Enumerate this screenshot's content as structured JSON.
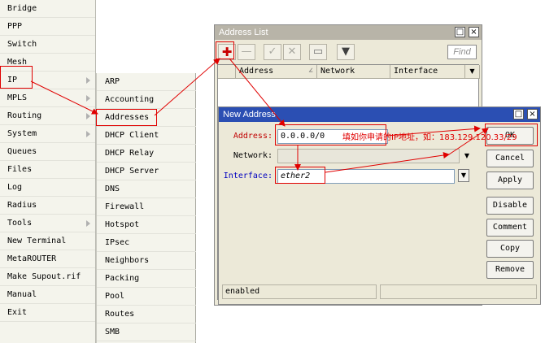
{
  "main_menu": {
    "items": [
      {
        "label": "Bridge",
        "has_submenu": false
      },
      {
        "label": "PPP",
        "has_submenu": false
      },
      {
        "label": "Switch",
        "has_submenu": false
      },
      {
        "label": "Mesh",
        "has_submenu": false
      },
      {
        "label": "IP",
        "has_submenu": true
      },
      {
        "label": "MPLS",
        "has_submenu": true
      },
      {
        "label": "Routing",
        "has_submenu": true
      },
      {
        "label": "System",
        "has_submenu": true
      },
      {
        "label": "Queues",
        "has_submenu": false
      },
      {
        "label": "Files",
        "has_submenu": false
      },
      {
        "label": "Log",
        "has_submenu": false
      },
      {
        "label": "Radius",
        "has_submenu": false
      },
      {
        "label": "Tools",
        "has_submenu": true
      },
      {
        "label": "New Terminal",
        "has_submenu": false
      },
      {
        "label": "MetaROUTER",
        "has_submenu": false
      },
      {
        "label": "Make Supout.rif",
        "has_submenu": false
      },
      {
        "label": "Manual",
        "has_submenu": false
      },
      {
        "label": "Exit",
        "has_submenu": false
      }
    ]
  },
  "ip_submenu": {
    "items": [
      {
        "label": "ARP"
      },
      {
        "label": "Accounting"
      },
      {
        "label": "Addresses"
      },
      {
        "label": "DHCP Client"
      },
      {
        "label": "DHCP Relay"
      },
      {
        "label": "DHCP Server"
      },
      {
        "label": "DNS"
      },
      {
        "label": "Firewall"
      },
      {
        "label": "Hotspot"
      },
      {
        "label": "IPsec"
      },
      {
        "label": "Neighbors"
      },
      {
        "label": "Packing"
      },
      {
        "label": "Pool"
      },
      {
        "label": "Routes"
      },
      {
        "label": "SMB"
      }
    ]
  },
  "address_list": {
    "title": "Address List",
    "find_placeholder": "Find",
    "columns": [
      "Address",
      "Network",
      "Interface"
    ],
    "toolbar_icons": [
      "add-icon",
      "remove-icon",
      "enable-icon",
      "disable-icon",
      "comment-icon",
      "filter-icon"
    ]
  },
  "new_address": {
    "title": "New Address",
    "address_label": "Address:",
    "address_value": "0.0.0.0/0",
    "network_label": "Network:",
    "network_value": "",
    "interface_label": "Interface:",
    "interface_value": "ether2",
    "buttons": {
      "ok": "OK",
      "cancel": "Cancel",
      "apply": "Apply",
      "disable": "Disable",
      "comment": "Comment",
      "copy": "Copy",
      "remove": "Remove"
    },
    "status": "enabled"
  },
  "annotation": {
    "text": "填如你申请的IP地址，如：183.129.120.33/29"
  },
  "colors": {
    "annotation_red": "#e00000",
    "new_address_titlebar": "#2b4fb3",
    "address_list_titlebar": "#b8b4a8",
    "menu_background": "#f4f4ec",
    "window_background": "#ece9d8",
    "add_plus_red": "#c80000",
    "label_blue": "#0000c0"
  }
}
